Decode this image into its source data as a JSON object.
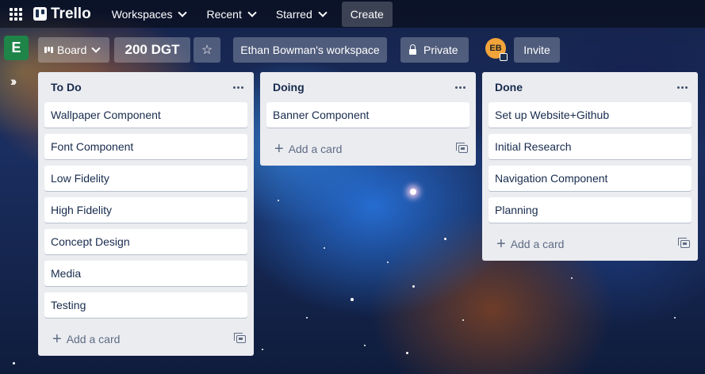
{
  "topnav": {
    "logo_text": "Trello",
    "workspaces_label": "Workspaces",
    "recent_label": "Recent",
    "starred_label": "Starred",
    "create_label": "Create"
  },
  "board": {
    "workspace_initial": "E",
    "view_label": "Board",
    "title": "200 DGT",
    "workspace_name": "Ethan Bowman's workspace",
    "visibility": "Private",
    "avatar_initials": "EB",
    "invite_label": "Invite"
  },
  "lists": [
    {
      "title": "To Do",
      "cards": [
        "Wallpaper Component",
        "Font Component",
        "Low Fidelity",
        "High Fidelity",
        "Concept Design",
        "Media",
        "Testing"
      ],
      "add_label": "Add a card"
    },
    {
      "title": "Doing",
      "cards": [
        "Banner Component"
      ],
      "add_label": "Add a card"
    },
    {
      "title": "Done",
      "cards": [
        "Set up Website+Github",
        "Initial Research",
        "Navigation Component",
        "Planning"
      ],
      "add_label": "Add a card"
    }
  ],
  "colors": {
    "workspace_tile": "#1f8448",
    "avatar": "#f2a33a",
    "list_bg": "#ebecf0"
  }
}
